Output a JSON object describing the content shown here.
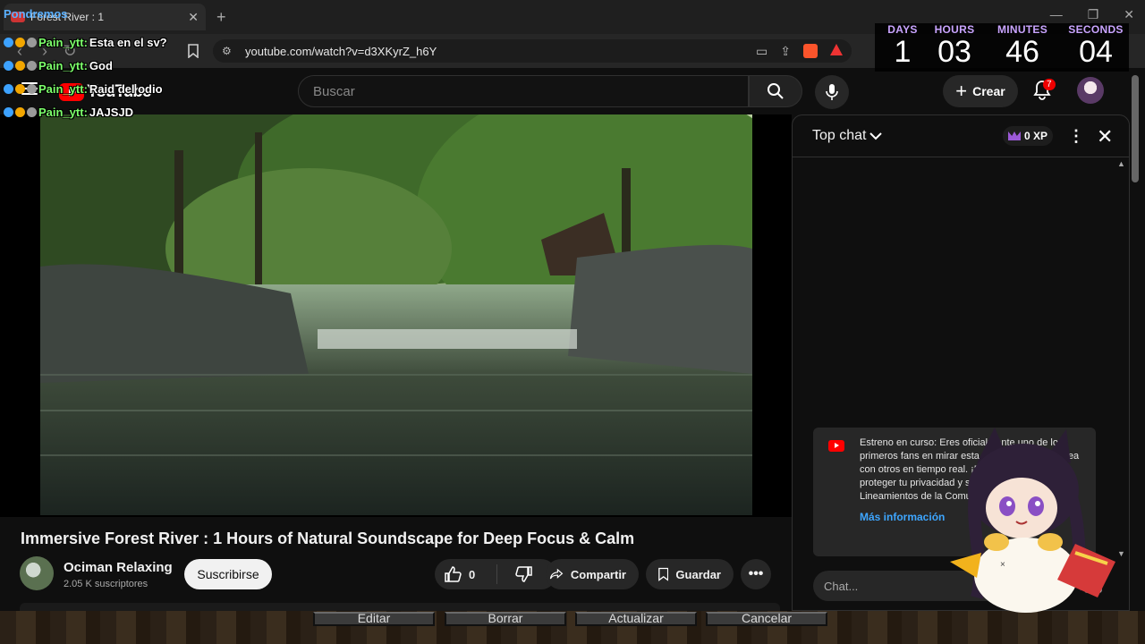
{
  "browser": {
    "tab_title": "Forest River : 1",
    "tab_overlay_label": "Pondremos",
    "url": "youtube.com/watch?v=d3XKyrZ_h6Y",
    "new_tab_symbol": "+",
    "window_controls": [
      "—",
      "❐",
      "✕"
    ]
  },
  "youtube": {
    "logo_text": "YouTube",
    "search_placeholder": "Buscar",
    "create_label": "Crear",
    "notification_count": "7",
    "video_title": "Immersive Forest River : 1 Hours of Natural Soundscape for Deep Focus & Calm",
    "channel_name": "Ociman Relaxing",
    "subscribers": "2.05 K suscriptores",
    "subscribe_label": "Suscribirse",
    "like_count": "0",
    "share_label": "Compartir",
    "save_label": "Guardar"
  },
  "chat": {
    "header": "Top chat",
    "xp": "0 XP",
    "premiere_text": "Estreno en curso: Eres oficialmente uno de los primeros fans en mirar esta en el estreno y chatea con otros en tiempo real. ¡Disfrútalo! Recuerda proteger tu privacidad y satisfacer nuestros Lineamientos de la Comunidad.",
    "more_info": "Más información",
    "input_placeholder": "Chat..."
  },
  "overlay_chat": [
    {
      "user": "Pain_ytt:",
      "message": "Esta en el sv?"
    },
    {
      "user": "Pain_ytt:",
      "message": "God"
    },
    {
      "user": "Pain_ytt:",
      "message": "Raid del odio"
    },
    {
      "user": "Pain_ytt:",
      "message": "JAJSJD"
    }
  ],
  "countdown": {
    "days_label": "DAYS",
    "days": "1",
    "hours_label": "HOURS",
    "hours": "03",
    "minutes_label": "MINUTES",
    "minutes": "46",
    "seconds_label": "SECONDS",
    "seconds": "04"
  },
  "bottom_buttons": [
    "Editar",
    "Borrar",
    "Actualizar",
    "Cancelar"
  ],
  "colors": {
    "youtube_red": "#ff0000",
    "overlay_user_green": "#7cff6b",
    "countdown_label_purple": "#c9a4ff",
    "link_blue": "#3ea6ff"
  },
  "icons": [
    "back-arrow-icon",
    "forward-arrow-icon",
    "reload-icon",
    "bookmark-icon",
    "search-icon",
    "mic-icon",
    "bell-icon",
    "like-icon",
    "dislike-icon",
    "share-icon",
    "save-icon",
    "more-icon",
    "chevron-down-icon",
    "close-icon",
    "send-icon"
  ]
}
